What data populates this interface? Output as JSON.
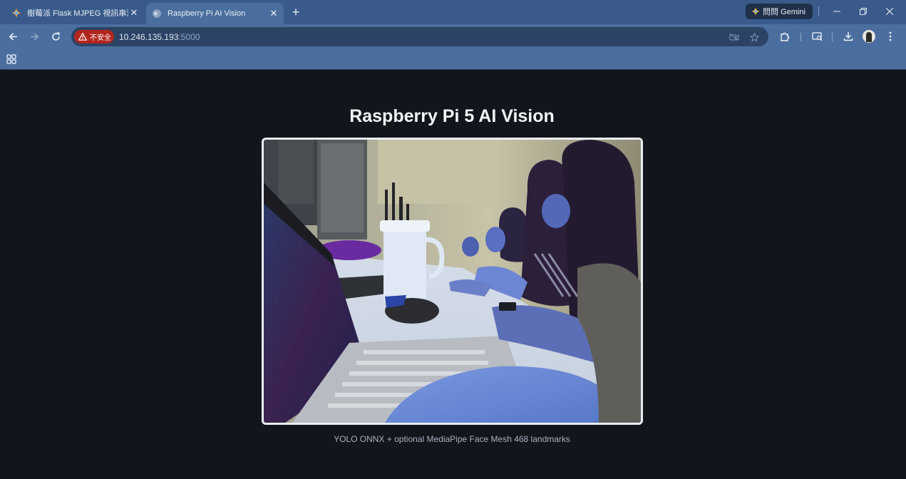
{
  "browser": {
    "tabs": [
      {
        "title": "樹莓派 Flask MJPEG 視訊串流",
        "active": false
      },
      {
        "title": "Raspberry Pi AI Vision",
        "active": true
      }
    ],
    "new_tab_symbol": "+",
    "gemini_label": "問問 Gemini",
    "security_badge": "不安全",
    "url_host": "10.246.135.193",
    "url_port": ":5000",
    "icons": {
      "back": "arrow-left-icon",
      "forward": "arrow-right-icon",
      "reload": "reload-icon",
      "extensions": "puzzle-icon",
      "tab_search": "tab-search-icon",
      "downloads": "download-icon",
      "menu": "kebab-menu-icon",
      "apps": "apps-grid-icon"
    },
    "colors": {
      "chrome_frame": "#395a8a",
      "toolbar": "#4a6e9e",
      "insecure_badge": "#b3261e",
      "page_background": "#11151c"
    }
  },
  "page": {
    "title": "Raspberry Pi 5 AI Vision",
    "video_alt": "Live camera stream",
    "caption": "YOLO ONNX + optional MediaPipe Face Mesh 468 landmarks"
  }
}
